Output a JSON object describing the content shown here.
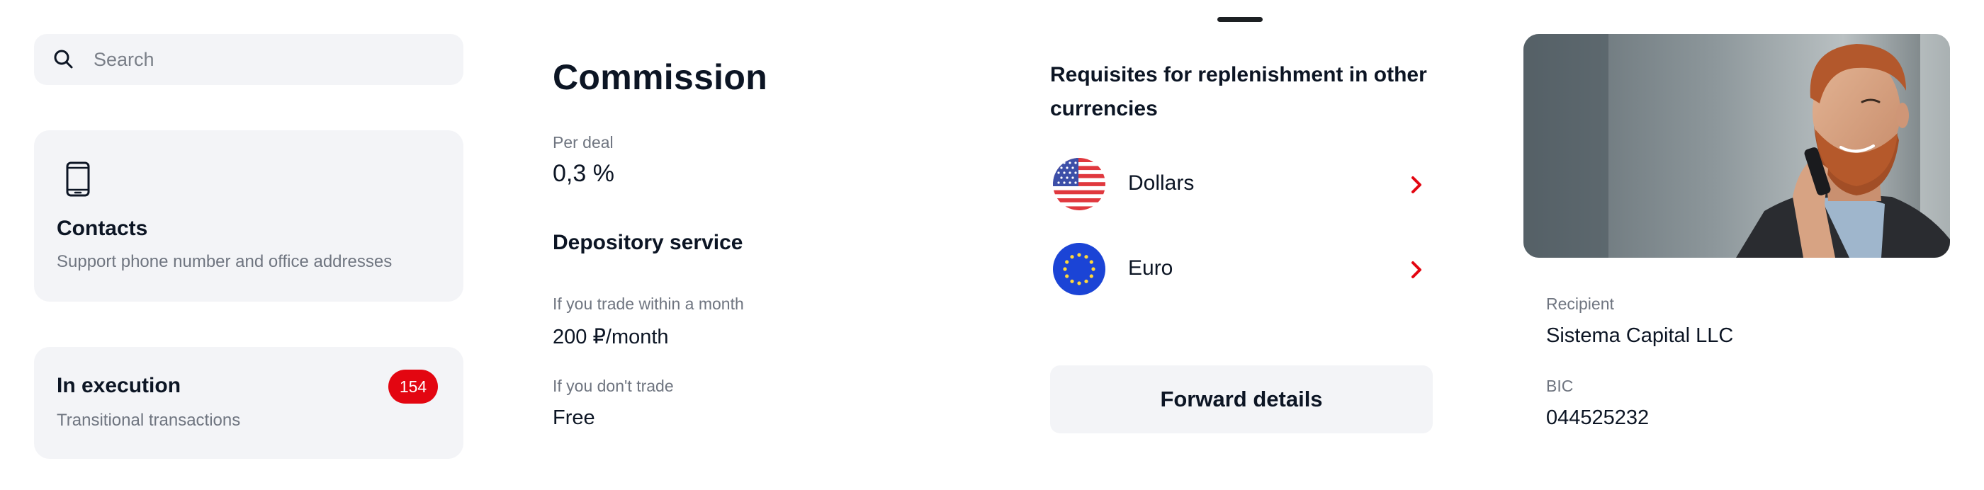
{
  "search": {
    "placeholder": "Search",
    "value": ""
  },
  "contacts": {
    "title": "Contacts",
    "subtitle": "Support phone number and office addresses",
    "icon": "smartphone-icon"
  },
  "execution": {
    "title": "In execution",
    "subtitle": "Transitional transactions",
    "badge": "154"
  },
  "commission": {
    "title": "Commission",
    "per_deal_label": "Per deal",
    "per_deal_value": "0,3 %",
    "depository_title": "Depository service",
    "trade_label": "If you trade within a month",
    "trade_value": "200 ₽/month",
    "no_trade_label": "If you don't trade",
    "no_trade_value": "Free"
  },
  "requisites": {
    "title": "Requisites for replenishment in other currencies",
    "currencies": [
      {
        "label": "Dollars",
        "icon": "us-flag-icon"
      },
      {
        "label": "Euro",
        "icon": "eu-flag-icon"
      }
    ],
    "forward_button": "Forward details"
  },
  "recipient": {
    "recipient_label": "Recipient",
    "recipient_value": "Sistema Capital LLC",
    "bic_label": "BIC",
    "bic_value": "044525232"
  },
  "colors": {
    "accent": "#e30611",
    "card_bg": "#f3f4f7",
    "text": "#0c1524",
    "muted": "#6f7580"
  }
}
